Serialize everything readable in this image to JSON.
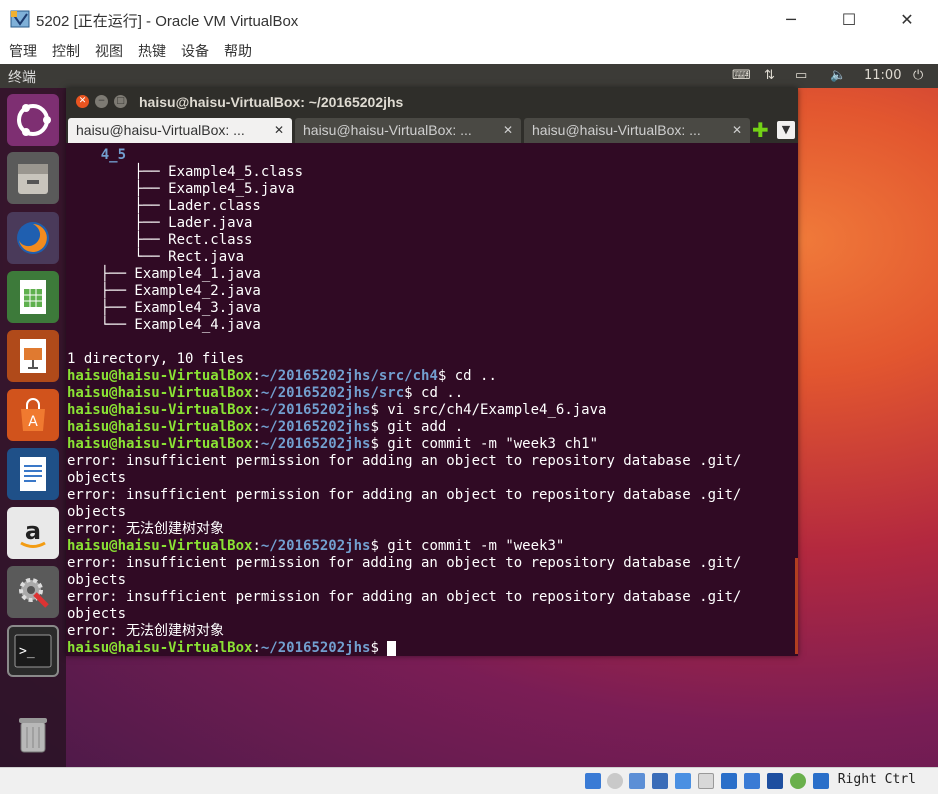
{
  "host": {
    "title": "5202 [正在运行] - Oracle VM VirtualBox",
    "menu": [
      "管理",
      "控制",
      "视图",
      "热键",
      "设备",
      "帮助"
    ],
    "status_hostkey": "Right Ctrl"
  },
  "guest": {
    "topbar": {
      "app_name": "终端",
      "time": "11:00"
    },
    "launcher": [
      "ubuntu-dash",
      "files",
      "firefox",
      "libreoffice-calc",
      "libreoffice-impress",
      "ubuntu-software",
      "libreoffice-writer",
      "amazon",
      "system-settings",
      "terminal",
      "trash"
    ],
    "terminal": {
      "window_title": "haisu@haisu-VirtualBox: ~/20165202jhs",
      "tabs": [
        {
          "label": "haisu@haisu-VirtualBox: ...",
          "active": true
        },
        {
          "label": "haisu@haisu-VirtualBox: ...",
          "active": false
        },
        {
          "label": "haisu@haisu-VirtualBox: ...",
          "active": false
        }
      ],
      "lines": [
        {
          "parts": [
            {
              "t": "    ",
              "c": ""
            },
            {
              "t": "4_5",
              "c": "dir"
            }
          ]
        },
        {
          "parts": [
            {
              "t": "        ├── Example4_5.class",
              "c": ""
            }
          ]
        },
        {
          "parts": [
            {
              "t": "        ├── Example4_5.java",
              "c": ""
            }
          ]
        },
        {
          "parts": [
            {
              "t": "        ├── Lader.class",
              "c": ""
            }
          ]
        },
        {
          "parts": [
            {
              "t": "        ├── Lader.java",
              "c": ""
            }
          ]
        },
        {
          "parts": [
            {
              "t": "        ├── Rect.class",
              "c": ""
            }
          ]
        },
        {
          "parts": [
            {
              "t": "        └── Rect.java",
              "c": ""
            }
          ]
        },
        {
          "parts": [
            {
              "t": "    ├── Example4_1.java",
              "c": ""
            }
          ]
        },
        {
          "parts": [
            {
              "t": "    ├── Example4_2.java",
              "c": ""
            }
          ]
        },
        {
          "parts": [
            {
              "t": "    ├── Example4_3.java",
              "c": ""
            }
          ]
        },
        {
          "parts": [
            {
              "t": "    └── Example4_4.java",
              "c": ""
            }
          ]
        },
        {
          "parts": [
            {
              "t": "",
              "c": ""
            }
          ]
        },
        {
          "parts": [
            {
              "t": "1 directory, 10 files",
              "c": ""
            }
          ]
        },
        {
          "parts": [
            {
              "t": "haisu@haisu-VirtualBox",
              "c": "u"
            },
            {
              "t": ":",
              "c": ""
            },
            {
              "t": "~/20165202jhs/src/ch4",
              "c": "p"
            },
            {
              "t": "$ cd ..",
              "c": ""
            }
          ]
        },
        {
          "parts": [
            {
              "t": "haisu@haisu-VirtualBox",
              "c": "u"
            },
            {
              "t": ":",
              "c": ""
            },
            {
              "t": "~/20165202jhs/src",
              "c": "p"
            },
            {
              "t": "$ cd ..",
              "c": ""
            }
          ]
        },
        {
          "parts": [
            {
              "t": "haisu@haisu-VirtualBox",
              "c": "u"
            },
            {
              "t": ":",
              "c": ""
            },
            {
              "t": "~/20165202jhs",
              "c": "p"
            },
            {
              "t": "$ vi src/ch4/Example4_6.java",
              "c": ""
            }
          ]
        },
        {
          "parts": [
            {
              "t": "haisu@haisu-VirtualBox",
              "c": "u"
            },
            {
              "t": ":",
              "c": ""
            },
            {
              "t": "~/20165202jhs",
              "c": "p"
            },
            {
              "t": "$ git add .",
              "c": ""
            }
          ]
        },
        {
          "parts": [
            {
              "t": "haisu@haisu-VirtualBox",
              "c": "u"
            },
            {
              "t": ":",
              "c": ""
            },
            {
              "t": "~/20165202jhs",
              "c": "p"
            },
            {
              "t": "$ git commit -m \"week3 ch1\"",
              "c": ""
            }
          ]
        },
        {
          "parts": [
            {
              "t": "error: insufficient permission for adding an object to repository database .git/",
              "c": ""
            }
          ]
        },
        {
          "parts": [
            {
              "t": "objects",
              "c": ""
            }
          ]
        },
        {
          "parts": [
            {
              "t": "error: insufficient permission for adding an object to repository database .git/",
              "c": ""
            }
          ]
        },
        {
          "parts": [
            {
              "t": "objects",
              "c": ""
            }
          ]
        },
        {
          "parts": [
            {
              "t": "error: 无法创建树对象",
              "c": ""
            }
          ]
        },
        {
          "parts": [
            {
              "t": "haisu@haisu-VirtualBox",
              "c": "u"
            },
            {
              "t": ":",
              "c": ""
            },
            {
              "t": "~/20165202jhs",
              "c": "p"
            },
            {
              "t": "$ git commit -m \"week3\"",
              "c": ""
            }
          ]
        },
        {
          "parts": [
            {
              "t": "error: insufficient permission for adding an object to repository database .git/",
              "c": ""
            }
          ]
        },
        {
          "parts": [
            {
              "t": "objects",
              "c": ""
            }
          ]
        },
        {
          "parts": [
            {
              "t": "error: insufficient permission for adding an object to repository database .git/",
              "c": ""
            }
          ]
        },
        {
          "parts": [
            {
              "t": "objects",
              "c": ""
            }
          ]
        },
        {
          "parts": [
            {
              "t": "error: 无法创建树对象",
              "c": ""
            }
          ]
        },
        {
          "parts": [
            {
              "t": "haisu@haisu-VirtualBox",
              "c": "u"
            },
            {
              "t": ":",
              "c": ""
            },
            {
              "t": "~/20165202jhs",
              "c": "p"
            },
            {
              "t": "$ ",
              "c": ""
            }
          ],
          "cursor": true
        }
      ]
    }
  },
  "colors": {
    "terminal_bg": "#300a24",
    "prompt_user": "#8ae234",
    "prompt_path": "#729fcf",
    "ubuntu_orange": "#e95420"
  }
}
